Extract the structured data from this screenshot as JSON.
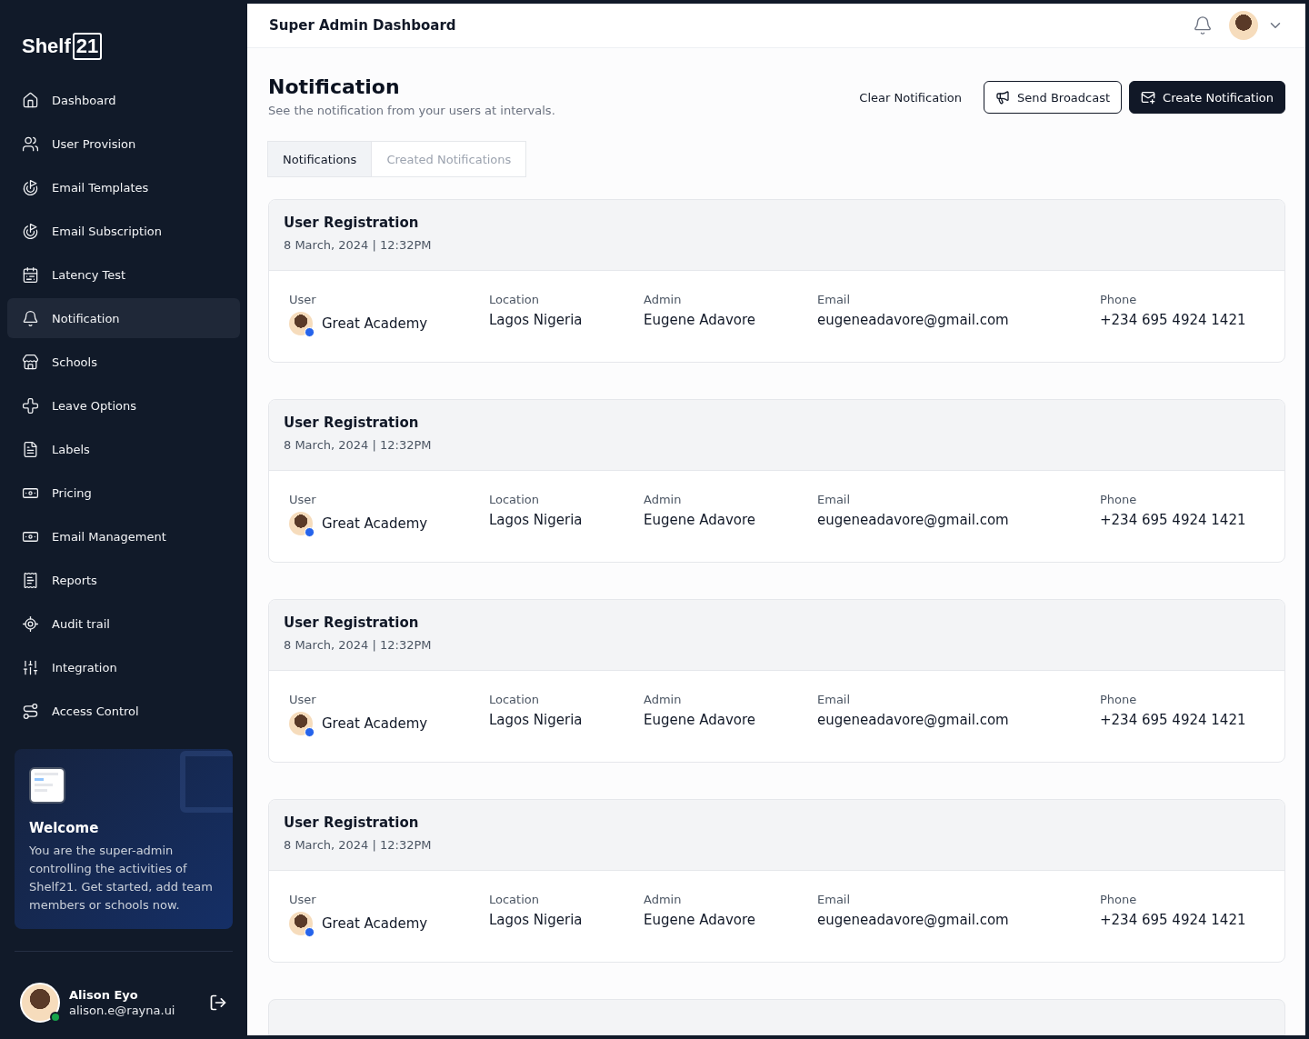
{
  "brand": {
    "name": "Shelf",
    "mark": "21"
  },
  "sidebar": {
    "items": [
      {
        "label": "Dashboard",
        "selected": false
      },
      {
        "label": "User Provision",
        "selected": false
      },
      {
        "label": "Email Templates",
        "selected": false
      },
      {
        "label": "Email Subscription",
        "selected": false
      },
      {
        "label": "Latency Test",
        "selected": false
      },
      {
        "label": "Notification",
        "selected": true
      },
      {
        "label": "Schools",
        "selected": false
      },
      {
        "label": "Leave Options",
        "selected": false
      },
      {
        "label": "Labels",
        "selected": false
      },
      {
        "label": "Pricing",
        "selected": false
      },
      {
        "label": "Email Management",
        "selected": false
      },
      {
        "label": "Reports",
        "selected": false
      },
      {
        "label": "Audit trail",
        "selected": false
      },
      {
        "label": "Integration",
        "selected": false
      },
      {
        "label": "Access Control",
        "selected": false
      }
    ],
    "promo": {
      "title": "Welcome",
      "text": "You are the super-admin controlling the activities of Shelf21. Get started, add team members or schools now."
    },
    "user": {
      "name": "Alison Eyo",
      "email": "alison.e@rayna.ui",
      "online": true
    }
  },
  "header": {
    "title": "Super Admin Dashboard"
  },
  "page": {
    "title": "Notification",
    "subtitle": "See the notification from your users at intervals.",
    "actions": [
      {
        "label": "Clear Notification",
        "kind": "link"
      },
      {
        "label": "Send Broadcast",
        "kind": "outline"
      },
      {
        "label": "Create Notification",
        "kind": "primary"
      }
    ]
  },
  "tabs": [
    {
      "label": "Notifications",
      "selected": true
    },
    {
      "label": "Created Notifications",
      "selected": false
    }
  ],
  "notifications": [
    {
      "title": "User Registration",
      "date": "8 March, 2024 | 12:32PM",
      "fields": [
        {
          "label": "User",
          "value": "Great Academy",
          "kind": "avatar"
        },
        {
          "label": "Location",
          "value": "Lagos Nigeria",
          "kind": "text"
        },
        {
          "label": "Admin",
          "value": "Eugene Adavore",
          "kind": "text"
        },
        {
          "label": "Email",
          "value": "eugeneadavore@gmail.com",
          "kind": "text"
        },
        {
          "label": "Phone",
          "value": "+234 695 4924 1421",
          "kind": "text"
        }
      ]
    },
    {
      "title": "User Registration",
      "date": "8 March, 2024 | 12:32PM",
      "fields": [
        {
          "label": "User",
          "value": "Great Academy",
          "kind": "avatar"
        },
        {
          "label": "Location",
          "value": "Lagos Nigeria",
          "kind": "text"
        },
        {
          "label": "Admin",
          "value": "Eugene Adavore",
          "kind": "text"
        },
        {
          "label": "Email",
          "value": "eugeneadavore@gmail.com",
          "kind": "text"
        },
        {
          "label": "Phone",
          "value": "+234 695 4924 1421",
          "kind": "text"
        }
      ]
    },
    {
      "title": "User Registration",
      "date": "8 March, 2024 | 12:32PM",
      "fields": [
        {
          "label": "User",
          "value": "Great Academy",
          "kind": "avatar"
        },
        {
          "label": "Location",
          "value": "Lagos Nigeria",
          "kind": "text"
        },
        {
          "label": "Admin",
          "value": "Eugene Adavore",
          "kind": "text"
        },
        {
          "label": "Email",
          "value": "eugeneadavore@gmail.com",
          "kind": "text"
        },
        {
          "label": "Phone",
          "value": "+234 695 4924 1421",
          "kind": "text"
        }
      ]
    },
    {
      "title": "User Registration",
      "date": "8 March, 2024 | 12:32PM",
      "fields": [
        {
          "label": "User",
          "value": "Great Academy",
          "kind": "avatar"
        },
        {
          "label": "Location",
          "value": "Lagos Nigeria",
          "kind": "text"
        },
        {
          "label": "Admin",
          "value": "Eugene Adavore",
          "kind": "text"
        },
        {
          "label": "Email",
          "value": "eugeneadavore@gmail.com",
          "kind": "text"
        },
        {
          "label": "Phone",
          "value": "+234 695 4924 1421",
          "kind": "text"
        }
      ]
    }
  ]
}
